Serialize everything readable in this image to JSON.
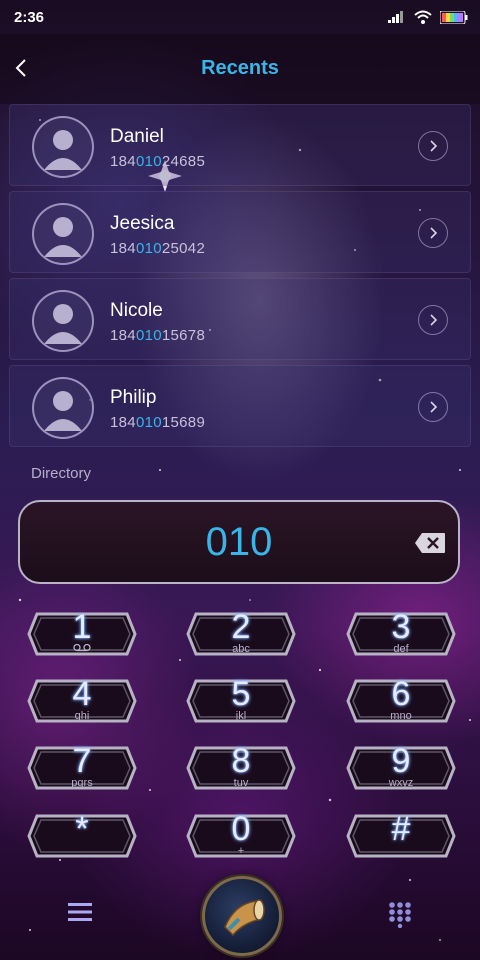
{
  "status": {
    "time": "2:36"
  },
  "header": {
    "title": "Recents"
  },
  "recents": [
    {
      "name": "Daniel",
      "num_prefix": "184",
      "num_match": "010",
      "num_suffix": "24685"
    },
    {
      "name": "Jeesica",
      "num_prefix": "184",
      "num_match": "010",
      "num_suffix": "25042"
    },
    {
      "name": "Nicole",
      "num_prefix": "184",
      "num_match": "010",
      "num_suffix": "15678"
    },
    {
      "name": "Philip",
      "num_prefix": "184",
      "num_match": "010",
      "num_suffix": "15689"
    }
  ],
  "directory_label": "Directory",
  "dialer": {
    "input_value": "010",
    "keys": [
      {
        "digit": "1",
        "letters": "voicemail-icon"
      },
      {
        "digit": "2",
        "letters": "abc"
      },
      {
        "digit": "3",
        "letters": "def"
      },
      {
        "digit": "4",
        "letters": "ghi"
      },
      {
        "digit": "5",
        "letters": "jkl"
      },
      {
        "digit": "6",
        "letters": "mno"
      },
      {
        "digit": "7",
        "letters": "pqrs"
      },
      {
        "digit": "8",
        "letters": "tuv"
      },
      {
        "digit": "9",
        "letters": "wxyz"
      },
      {
        "digit": "*",
        "letters": ""
      },
      {
        "digit": "0",
        "letters": "+"
      },
      {
        "digit": "#",
        "letters": ""
      }
    ]
  },
  "colors": {
    "accent": "#38b6e8"
  }
}
